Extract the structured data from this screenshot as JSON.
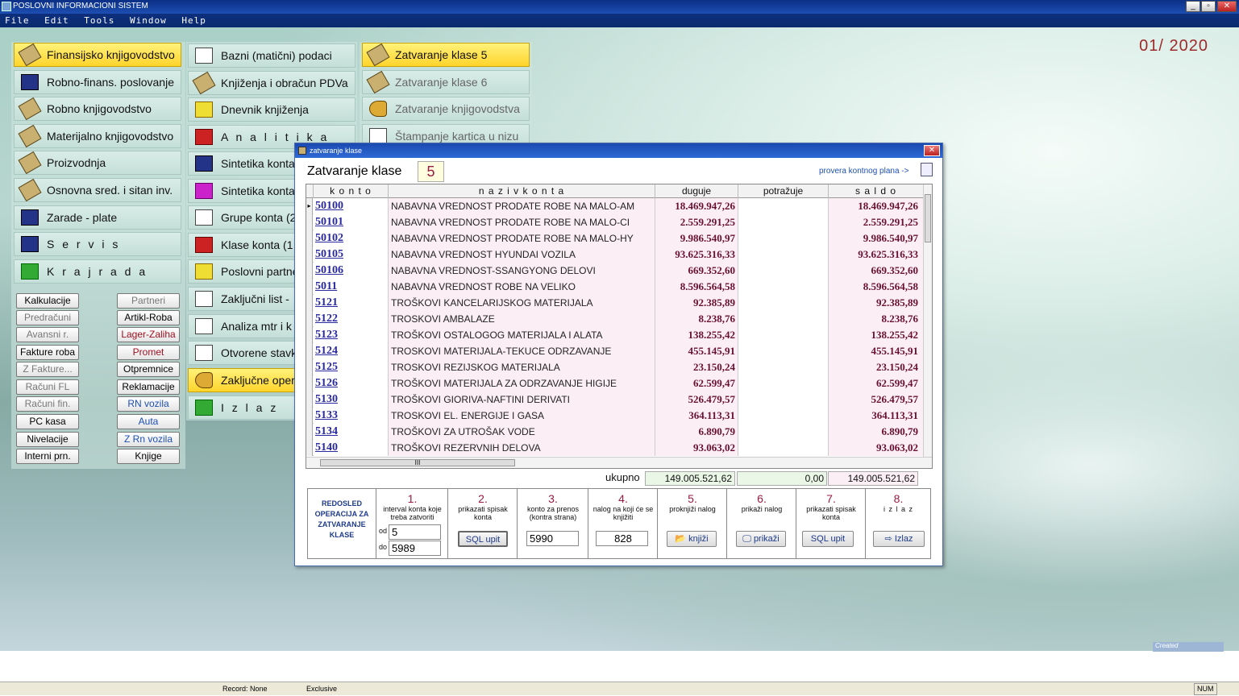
{
  "app": {
    "title": "POSLOVNI INFORMACIONI SISTEM",
    "menu": [
      "File",
      "Edit",
      "Tools",
      "Window",
      "Help"
    ],
    "period": "01/ 2020"
  },
  "main_menu": [
    {
      "label": "Finansijsko knjigovodstvo"
    },
    {
      "label": "Robno-finans. poslovanje"
    },
    {
      "label": "Robno knjigovodstvo"
    },
    {
      "label": "Materijalno knjigovodstvo"
    },
    {
      "label": "Proizvodnja"
    },
    {
      "label": "Osnovna sred. i sitan inv."
    },
    {
      "label": "Zarade - plate"
    },
    {
      "label": "S e r v i s"
    },
    {
      "label": "K r a j   r a d a"
    }
  ],
  "small_buttons_left": [
    "Kalkulacije",
    "Predračuni",
    "Avansni r.",
    "Fakture roba",
    "Z Fakture...",
    "Računi FL",
    "Računi fin.",
    "PC kasa",
    "Nivelacije",
    "Interni prn."
  ],
  "small_buttons_right": [
    "Partneri",
    "Artikl-Roba",
    "Lager-Zaliha",
    "Promet",
    "Otpremnice",
    "Reklamacije",
    "RN vozila",
    "Auta",
    "Z Rn vozila",
    "Knjige"
  ],
  "sub_menu": [
    "Bazni (matični) podaci",
    "Knjiženja i obračun PDVa",
    "Dnevnik knjiženja",
    "A n a l i t i k a",
    "Sintetika konta",
    "Sintetika konta",
    "Grupe konta (2",
    "Klase konta (1",
    "Poslovni partne",
    "Zaključni list -",
    "Analiza mtr i k",
    "Otvorene stavk",
    "Zaključne oper",
    "I z l a z"
  ],
  "sub_menu2": [
    "Zatvaranje klase 5",
    "Zatvaranje klase 6",
    "Zatvaranje knjigovodstva",
    "Štampanje kartica u nizu"
  ],
  "dialog": {
    "window_title": "zatvaranje klase",
    "heading": "Zatvaranje klase",
    "klasa": "5",
    "provera_link": "provera kontnog plana ->",
    "columns": [
      "k o n t o",
      "n a z i v   k o n t a",
      "duguje",
      "potražuje",
      "s a l d o"
    ],
    "rows": [
      {
        "konto": "50100",
        "naziv": "NABAVNA VREDNOST PRODATE ROBE NA MALO-AM",
        "duguje": "18.469.947,26",
        "potrazuje": "",
        "saldo": "18.469.947,26"
      },
      {
        "konto": "50101",
        "naziv": "NABAVNA VREDNOST PRODATE ROBE NA MALO-CI",
        "duguje": "2.559.291,25",
        "potrazuje": "",
        "saldo": "2.559.291,25"
      },
      {
        "konto": "50102",
        "naziv": "NABAVNA VREDNOST PRODATE ROBE NA MALO-HY",
        "duguje": "9.986.540,97",
        "potrazuje": "",
        "saldo": "9.986.540,97"
      },
      {
        "konto": "50105",
        "naziv": "NABAVNA VREDNOST HYUNDAI VOZILA",
        "duguje": "93.625.316,33",
        "potrazuje": "",
        "saldo": "93.625.316,33"
      },
      {
        "konto": "50106",
        "naziv": "NABAVNA VREDNOST-SSANGYONG DELOVI",
        "duguje": "669.352,60",
        "potrazuje": "",
        "saldo": "669.352,60"
      },
      {
        "konto": "5011",
        "naziv": "NABAVNA VREDNOST ROBE NA VELIKO",
        "duguje": "8.596.564,58",
        "potrazuje": "",
        "saldo": "8.596.564,58"
      },
      {
        "konto": "5121",
        "naziv": "TROŠKOVI KANCELARIJSKOG MATERIJALA",
        "duguje": "92.385,89",
        "potrazuje": "",
        "saldo": "92.385,89"
      },
      {
        "konto": "5122",
        "naziv": "TROSKOVI AMBALAZE",
        "duguje": "8.238,76",
        "potrazuje": "",
        "saldo": "8.238,76"
      },
      {
        "konto": "5123",
        "naziv": "TROŠKOVI OSTALOGOG MATERIJALA I ALATA",
        "duguje": "138.255,42",
        "potrazuje": "",
        "saldo": "138.255,42"
      },
      {
        "konto": "5124",
        "naziv": "TROSKOVI MATERIJALA-TEKUCE ODRZAVANJE",
        "duguje": "455.145,91",
        "potrazuje": "",
        "saldo": "455.145,91"
      },
      {
        "konto": "5125",
        "naziv": "TROSKOVI REZIJSKOG MATERIJALA",
        "duguje": "23.150,24",
        "potrazuje": "",
        "saldo": "23.150,24"
      },
      {
        "konto": "5126",
        "naziv": "TROŠKOVI MATERIJALA ZA ODRZAVANJE HIGIJE",
        "duguje": "62.599,47",
        "potrazuje": "",
        "saldo": "62.599,47"
      },
      {
        "konto": "5130",
        "naziv": "TROŠKOVI GIORIVA-NAFTINI DERIVATI",
        "duguje": "526.479,57",
        "potrazuje": "",
        "saldo": "526.479,57"
      },
      {
        "konto": "5133",
        "naziv": "TROSKOVI EL. ENERGIJE I GASA",
        "duguje": "364.113,31",
        "potrazuje": "",
        "saldo": "364.113,31"
      },
      {
        "konto": "5134",
        "naziv": "TROŠKOVI ZA UTROŠAK VODE",
        "duguje": "6.890,79",
        "potrazuje": "",
        "saldo": "6.890,79"
      },
      {
        "konto": "5140",
        "naziv": "TROŠKOVI REZERVNIH DELOVA",
        "duguje": "93.063,02",
        "potrazuje": "",
        "saldo": "93.063,02"
      }
    ],
    "ukupno_label": "ukupno",
    "ukupno_duguje": "149.005.521,62",
    "ukupno_potrazuje": "0,00",
    "ukupno_saldo": "149.005.521,62",
    "redosled": "REDOSLED OPERACIJA ZA ZATVARANJE KLASE",
    "steps": [
      {
        "num": "1.",
        "label": "interval konta koje treba zatvoriti",
        "od_label": "od",
        "od": "5",
        "do_label": "do",
        "do": "5989"
      },
      {
        "num": "2.",
        "label": "prikazati spisak konta",
        "button": "SQL upit"
      },
      {
        "num": "3.",
        "label": "konto za prenos (kontra strana)",
        "value": "5990"
      },
      {
        "num": "4.",
        "label": "nalog na koji će se knjižiti",
        "value": "828"
      },
      {
        "num": "5.",
        "label": "proknjiži nalog",
        "button": "knjiži"
      },
      {
        "num": "6.",
        "label": "prikaži nalog",
        "button": "prikaži"
      },
      {
        "num": "7.",
        "label": "prikazati spisak konta",
        "button": "SQL upit"
      },
      {
        "num": "8.",
        "label": "i z l a z",
        "button": "Izlaz"
      }
    ]
  },
  "status": {
    "record": "Record: None",
    "mode": "Exclusive",
    "num": "NUM",
    "created": "Created"
  }
}
